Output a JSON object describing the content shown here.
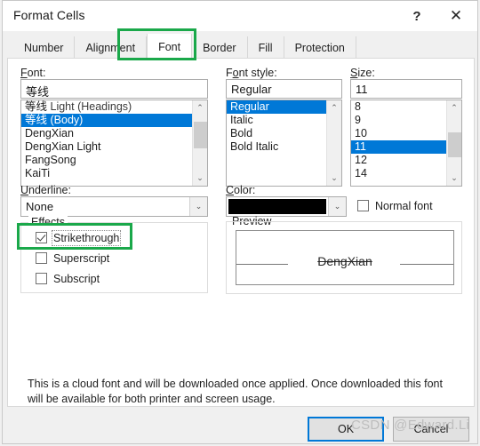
{
  "window": {
    "title": "Format Cells",
    "help_icon": "help-question-icon",
    "close_icon": "close-x-icon",
    "help_glyph": "?",
    "close_glyph": "✕"
  },
  "tabs": [
    {
      "label": "Number",
      "active": false
    },
    {
      "label": "Alignment",
      "active": false
    },
    {
      "label": "Font",
      "active": true
    },
    {
      "label": "Border",
      "active": false
    },
    {
      "label": "Fill",
      "active": false
    },
    {
      "label": "Protection",
      "active": false
    }
  ],
  "font_section": {
    "label": "Font:",
    "input_value": "等线",
    "items": [
      {
        "main": "等线",
        "sub": " Light (Headings)",
        "selected": false
      },
      {
        "main": "等线",
        "sub": " (Body)",
        "selected": true
      },
      {
        "main": "DengXian",
        "sub": "",
        "selected": false
      },
      {
        "main": "DengXian Light",
        "sub": "",
        "selected": false
      },
      {
        "main": "FangSong",
        "sub": "",
        "selected": false
      },
      {
        "main": "KaiTi",
        "sub": "",
        "selected": false
      }
    ],
    "scroll_up_glyph": "⌃",
    "scroll_down_glyph": "⌄"
  },
  "style_section": {
    "label": "Font style:",
    "input_value": "Regular",
    "items": [
      {
        "main": "Regular",
        "selected": true
      },
      {
        "main": "Italic",
        "selected": false
      },
      {
        "main": "Bold",
        "selected": false
      },
      {
        "main": "Bold Italic",
        "selected": false
      }
    ]
  },
  "size_section": {
    "label": "Size:",
    "input_value": "11",
    "items": [
      {
        "main": "8",
        "selected": false
      },
      {
        "main": "9",
        "selected": false
      },
      {
        "main": "10",
        "selected": false
      },
      {
        "main": "11",
        "selected": true
      },
      {
        "main": "12",
        "selected": false
      },
      {
        "main": "14",
        "selected": false
      }
    ]
  },
  "underline_section": {
    "label": "Underline:",
    "value": "None",
    "arrow_glyph": "⌄"
  },
  "color_section": {
    "label": "Color:",
    "value_color": "#000000",
    "arrow_glyph": "⌄"
  },
  "normal_font": {
    "label": "Normal font",
    "checked": false
  },
  "effects": {
    "group_title": "Effects",
    "items": [
      {
        "label": "Strikethrough",
        "checked": true,
        "focused": true
      },
      {
        "label": "Superscript",
        "checked": false,
        "focused": false
      },
      {
        "label": "Subscript",
        "checked": false,
        "focused": false
      }
    ]
  },
  "preview": {
    "group_title": "Preview",
    "sample_text": "DengXian"
  },
  "description": "This is a cloud font and will be downloaded once applied. Once downloaded this font will be available for both printer and screen usage.",
  "footer": {
    "ok_label": "OK",
    "cancel_label": "Cancel"
  },
  "watermark": "CSDN @Edward.Li",
  "annotations": {
    "accent_color": "#1aa84a",
    "selection_color": "#0078d7"
  }
}
